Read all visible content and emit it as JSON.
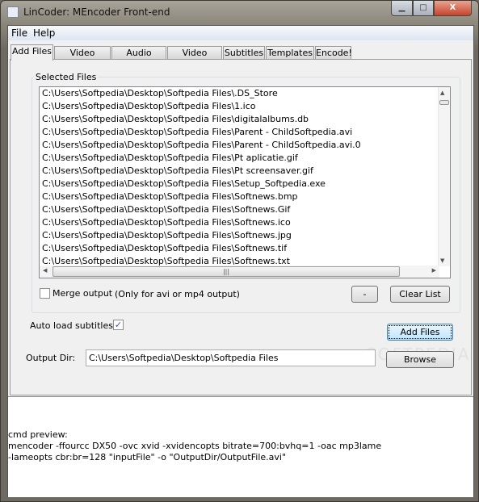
{
  "window": {
    "title": "LinCoder: MEncoder Front-end",
    "minimize": "▁",
    "maximize": "□",
    "close": "X"
  },
  "menu": [
    "File",
    "Help"
  ],
  "tabs": [
    "Add Files",
    "Video Codec",
    "Audio Codec",
    "Video Filters",
    "Subtitles",
    "Templates",
    "Encode!"
  ],
  "selected_files": {
    "label": "Selected Files",
    "items": [
      "C:\\Users\\Softpedia\\Desktop\\Softpedia Files\\.DS_Store",
      "C:\\Users\\Softpedia\\Desktop\\Softpedia Files\\1.ico",
      "C:\\Users\\Softpedia\\Desktop\\Softpedia Files\\digitalalbums.db",
      "C:\\Users\\Softpedia\\Desktop\\Softpedia Files\\Parent - ChildSoftpedia.avi",
      "C:\\Users\\Softpedia\\Desktop\\Softpedia Files\\Parent - ChildSoftpedia.avi.0",
      "C:\\Users\\Softpedia\\Desktop\\Softpedia Files\\Pt aplicatie.gif",
      "C:\\Users\\Softpedia\\Desktop\\Softpedia Files\\Pt screensaver.gif",
      "C:\\Users\\Softpedia\\Desktop\\Softpedia Files\\Setup_Softpedia.exe",
      "C:\\Users\\Softpedia\\Desktop\\Softpedia Files\\Softnews.bmp",
      "C:\\Users\\Softpedia\\Desktop\\Softpedia Files\\Softnews.Gif",
      "C:\\Users\\Softpedia\\Desktop\\Softpedia Files\\Softnews.ico",
      "C:\\Users\\Softpedia\\Desktop\\Softpedia Files\\Softnews.jpg",
      "C:\\Users\\Softpedia\\Desktop\\Softpedia Files\\Softnews.tif",
      "C:\\Users\\Softpedia\\Desktop\\Softpedia Files\\Softnews.txt"
    ]
  },
  "merge": {
    "label": "Merge output",
    "note": "(Only for avi or mp4 output)",
    "checked": false
  },
  "remove_label": "-",
  "clear_label": "Clear List",
  "auto_subs": {
    "label": "Auto load subtitles:",
    "checked": true,
    "mark": "✓"
  },
  "add_files_label": "Add Files",
  "output_dir": {
    "label": "Output Dir:",
    "value": "C:\\Users\\Softpedia\\Desktop\\Softpedia Files"
  },
  "browse_label": "Browse",
  "preview": {
    "label": "cmd preview:",
    "line1": "mencoder -ffourcc DX50 -ovc xvid -xvidencopts bitrate=700:bvhq=1 -oac mp3lame",
    "line2": "-lameopts cbr:br=128 \"inputFile\" -o \"OutputDir/OutputFile.avi\""
  },
  "watermark": "SOFTPEDIA"
}
